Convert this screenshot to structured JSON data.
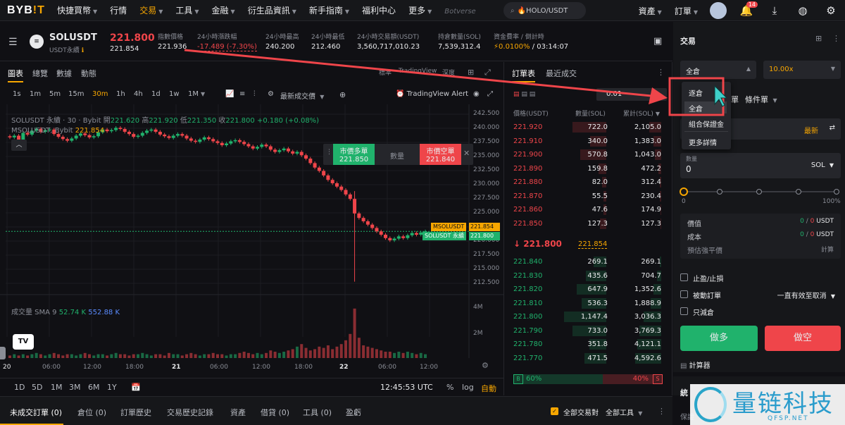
{
  "nav": {
    "logo_main": "BYB",
    "logo_accent": "!T",
    "items": [
      {
        "label": "快捷買幣",
        "caret": true
      },
      {
        "label": "行情",
        "caret": false
      },
      {
        "label": "交易",
        "caret": true,
        "active": true
      },
      {
        "label": "工具",
        "caret": true
      },
      {
        "label": "金融",
        "caret": true
      },
      {
        "label": "衍生品資訊",
        "caret": true
      },
      {
        "label": "新手指南",
        "caret": true
      },
      {
        "label": "福利中心",
        "caret": false
      },
      {
        "label": "更多",
        "caret": true
      },
      {
        "label": "Botverse",
        "caret": false
      }
    ],
    "search_text": "🔥HOLO/USDT",
    "assets_label": "資產",
    "orders_label": "訂單",
    "notification_count": "14"
  },
  "ticker": {
    "symbol": "SOLUSDT",
    "subtitle": "USDT永續",
    "last_price": "221.800",
    "mark_price": "221.854",
    "stats": [
      {
        "label": "指數價格",
        "value": "221.936",
        "color": "#e9eaec"
      },
      {
        "label": "24小時漲跌幅",
        "value": "-17.489 (-7.30%)",
        "color": "#ef454a"
      },
      {
        "label": "24小時最高",
        "value": "240.200",
        "color": "#e9eaec"
      },
      {
        "label": "24小時最低",
        "value": "212.460",
        "color": "#e9eaec"
      },
      {
        "label": "24小時交易額(USDT)",
        "value": "3,560,717,010.23",
        "color": "#e9eaec"
      },
      {
        "label": "持倉數量(SOL)",
        "value": "7,539,312.4",
        "color": "#e9eaec"
      },
      {
        "label": "資金費率 / 倒計時",
        "value": "0.0100%",
        "value2": " / 03:14:07",
        "color": "#f7a600"
      }
    ]
  },
  "chart_tabs": [
    "圖表",
    "總覽",
    "數據",
    "動態"
  ],
  "chart_views": [
    "標準",
    "TradingView",
    "深度"
  ],
  "timeframes": [
    "1s",
    "1m",
    "5m",
    "15m",
    "30m",
    "1h",
    "4h",
    "1d",
    "1w",
    "1M"
  ],
  "active_timeframe": "30m",
  "latest_price_toggle": "最新成交價",
  "tv_alert": "TradingView Alert",
  "legend": {
    "line1_sym": "SOLUSDT 永續 · 30 · Bybit",
    "o_lbl": "開",
    "o": "221.620",
    "h_lbl": "高",
    "h": "221.920",
    "l_lbl": "低",
    "l": "221.350",
    "c_lbl": "收",
    "c": "221.800",
    "chg": "+0.180 (+0.08%)",
    "line2_sym": "MSOLUSDT, Bybit",
    "line2_val": "221.854"
  },
  "quick_trade": {
    "buy_label": "市價多單",
    "buy_price": "221.850",
    "qty_label": "數量",
    "sell_label": "市價空單",
    "sell_price": "221.840"
  },
  "y_labels": [
    "242.500",
    "240.000",
    "237.500",
    "235.000",
    "232.500",
    "230.000",
    "227.500",
    "225.000",
    "222.500",
    "220.000",
    "217.500",
    "215.000",
    "212.500"
  ],
  "price_tags": {
    "m_label": "MSOLUSDT",
    "m_value": "221.854",
    "s_label": "SOLUSDT 永續",
    "s_value": "221.800"
  },
  "volume": {
    "label": "成交量 SMA 9",
    "v1": "52.74 K",
    "v2": "552.88 K",
    "y1": "4M",
    "y2": "2M"
  },
  "x_labels": [
    "20",
    "06:00",
    "12:00",
    "18:00",
    "21",
    "06:00",
    "12:00",
    "18:00",
    "22",
    "06:00",
    "12:00"
  ],
  "ranges": [
    "1D",
    "5D",
    "1M",
    "3M",
    "6M",
    "1Y"
  ],
  "clock": "12:45:53 UTC",
  "axis_opts": [
    "%",
    "log",
    "自動"
  ],
  "chart_data": {
    "type": "candlestick",
    "ylim": [
      211.5,
      243.5
    ],
    "closes": [
      238.6,
      238.9,
      238.2,
      239.4,
      239.1,
      239.8,
      240.1,
      239.6,
      239.9,
      240.0,
      239.2,
      238.7,
      238.3,
      238.0,
      238.4,
      238.9,
      239.3,
      239.0,
      238.6,
      238.8,
      239.5,
      240.0,
      239.7,
      239.9,
      240.3,
      240.1,
      239.6,
      239.2,
      238.7,
      238.9,
      239.4,
      239.8,
      240.0,
      239.6,
      239.1,
      238.8,
      238.5,
      238.9,
      239.2,
      238.9,
      238.4,
      238.0,
      237.8,
      238.2,
      238.6,
      238.3,
      237.9,
      237.6,
      237.2,
      237.5,
      237.9,
      238.1,
      237.8,
      237.4,
      237.0,
      236.6,
      236.9,
      237.3,
      237.0,
      236.4,
      236.0,
      236.3,
      236.6,
      236.1,
      235.7,
      236.0,
      235.4,
      234.8,
      234.0,
      233.2,
      232.6,
      231.8,
      231.0,
      230.4,
      229.8,
      229.2,
      228.4,
      227.6,
      225.0,
      224.2,
      223.6,
      223.0,
      222.4,
      221.8,
      221.2,
      220.6,
      220.2,
      220.5,
      220.9,
      220.6,
      221.1,
      221.5,
      221.2,
      221.6,
      221.8
    ],
    "volume": [
      0.2,
      0.3,
      0.2,
      0.3,
      0.2,
      0.3,
      0.4,
      0.3,
      0.2,
      0.3,
      0.4,
      0.3,
      0.2,
      0.3,
      0.3,
      0.2,
      0.3,
      0.4,
      0.3,
      0.2,
      0.3,
      0.3,
      0.2,
      0.3,
      0.4,
      0.3,
      0.3,
      0.2,
      0.3,
      0.3,
      0.4,
      0.3,
      0.2,
      0.3,
      0.3,
      0.2,
      0.4,
      0.3,
      0.3,
      0.2,
      0.3,
      0.4,
      0.3,
      0.2,
      0.3,
      0.3,
      0.4,
      0.3,
      0.3,
      0.2,
      0.3,
      0.3,
      0.4,
      0.5,
      0.4,
      0.3,
      0.4,
      0.3,
      0.4,
      0.6,
      0.5,
      0.4,
      0.5,
      0.6,
      0.7,
      0.9,
      1.1,
      0.8,
      0.6,
      0.7,
      0.9,
      0.8,
      1.0,
      0.7,
      0.9,
      1.1,
      1.4,
      1.9,
      3.9,
      1.6,
      1.0,
      0.9,
      0.8,
      0.7,
      0.6,
      0.5,
      0.5,
      0.4,
      0.5,
      0.4,
      0.5,
      0.4,
      0.3,
      0.4,
      0.3
    ]
  },
  "book": {
    "tabs": [
      "訂單表",
      "最近成交"
    ],
    "precision": "0.01",
    "headers": [
      "價格(USDT)",
      "數量(SOL)",
      "累計(SOL)"
    ],
    "asks": [
      {
        "p": "221.920",
        "q": "722.0",
        "c": "2,105.0",
        "qf": 0.8,
        "cf": 0.28
      },
      {
        "p": "221.910",
        "q": "340.0",
        "c": "1,383.0",
        "qf": 0.38,
        "cf": 0.18
      },
      {
        "p": "221.900",
        "q": "570.8",
        "c": "1,043.0",
        "qf": 0.62,
        "cf": 0.14
      },
      {
        "p": "221.890",
        "q": "159.8",
        "c": "472.2",
        "qf": 0.18,
        "cf": 0.06
      },
      {
        "p": "221.880",
        "q": "82.0",
        "c": "312.4",
        "qf": 0.1,
        "cf": 0.04
      },
      {
        "p": "221.870",
        "q": "55.5",
        "c": "230.4",
        "qf": 0.07,
        "cf": 0.03
      },
      {
        "p": "221.860",
        "q": "47.6",
        "c": "174.9",
        "qf": 0.06,
        "cf": 0.02
      },
      {
        "p": "221.850",
        "q": "127.3",
        "c": "127.3",
        "qf": 0.15,
        "cf": 0.02
      }
    ],
    "mid_price": "221.800",
    "mid_mark": "221.854",
    "bids": [
      {
        "p": "221.840",
        "q": "269.1",
        "c": "269.1",
        "qf": 0.3,
        "cf": 0.04
      },
      {
        "p": "221.830",
        "q": "435.6",
        "c": "704.7",
        "qf": 0.48,
        "cf": 0.09
      },
      {
        "p": "221.820",
        "q": "647.9",
        "c": "1,352.6",
        "qf": 0.7,
        "cf": 0.18
      },
      {
        "p": "221.810",
        "q": "536.3",
        "c": "1,888.9",
        "qf": 0.58,
        "cf": 0.25
      },
      {
        "p": "221.800",
        "q": "1,147.4",
        "c": "3,036.3",
        "qf": 1.0,
        "cf": 0.4
      },
      {
        "p": "221.790",
        "q": "733.0",
        "c": "3,769.3",
        "qf": 0.8,
        "cf": 0.5
      },
      {
        "p": "221.780",
        "q": "351.8",
        "c": "4,121.1",
        "qf": 0.4,
        "cf": 0.55
      },
      {
        "p": "221.770",
        "q": "471.5",
        "c": "4,592.6",
        "qf": 0.52,
        "cf": 0.6
      }
    ],
    "buy_letter": "B",
    "sell_letter": "S",
    "buy_pct": "60%",
    "sell_pct": "40%",
    "buy_ratio": 0.6
  },
  "trade": {
    "title": "交易",
    "margin_mode": "全倉",
    "leverage": "10.00x",
    "tab_partial": "單",
    "tab_conditional": "條件單",
    "price_mode": "最新",
    "qty_label": "數量",
    "qty_value": "0",
    "qty_unit": "SOL",
    "slider_min": "0",
    "slider_max": "100%",
    "info": [
      {
        "label": "價值",
        "value": "0",
        "value2": "0",
        "unit": "USDT"
      },
      {
        "label": "成本",
        "value": "0",
        "value2": "0",
        "unit": "USDT"
      }
    ],
    "liq_label": "預估強平價",
    "liq_value": "計算",
    "checks": [
      "止盈/止損",
      "被動訂單",
      "只減倉"
    ],
    "tif": "一直有效至取消",
    "long_btn": "做多",
    "short_btn": "做空",
    "calculator": "計算器",
    "section2": "統",
    "section2_sub": "保證"
  },
  "dropdown": [
    "逐倉",
    "全倉",
    "組合保證金",
    "更多詳情"
  ],
  "bottom_tabs": [
    "未成交訂單 (0)",
    "倉位 (0)",
    "訂單歷史",
    "交易歷史記錄",
    "資產",
    "借貸 (0)",
    "工具 (0)",
    "盈虧"
  ],
  "bottom_right": {
    "all_label": "全部交易對",
    "tools_label": "全部工具"
  },
  "watermark": {
    "text": "量链科技",
    "sub": "QFSP.NET"
  }
}
